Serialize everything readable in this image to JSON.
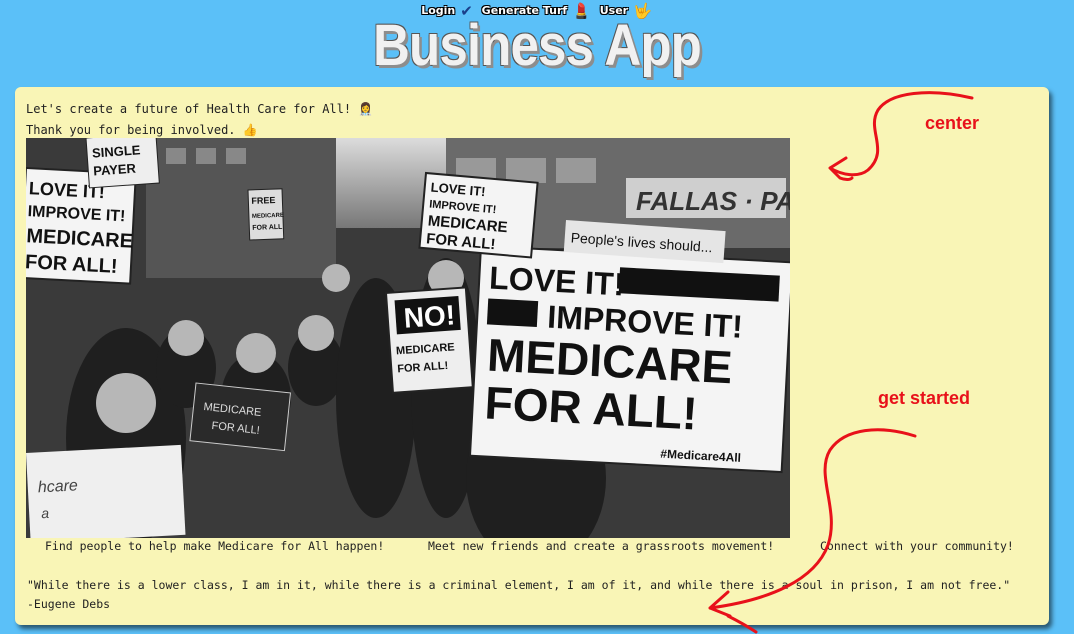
{
  "nav": {
    "items": [
      {
        "label": "Login",
        "icon": "✔"
      },
      {
        "label": "Generate Turf",
        "icon": "💄"
      },
      {
        "label": "User",
        "icon": "🤟"
      }
    ]
  },
  "app_title": "Business App",
  "intro": {
    "line1": "Let's create a future of Health Care for All!",
    "line1_icon": "👩‍⚕️",
    "line2": "Thank you for being involved.",
    "line2_icon": "👍"
  },
  "photo": {
    "signs": [
      {
        "lines": [
          "LOVE IT!",
          "IMPROVE IT!",
          "MEDICARE",
          "FOR ALL!",
          "#Medicare4All"
        ]
      },
      {
        "lines": [
          "LOVE IT!",
          "IMPROVE IT!",
          "MEDICARE",
          "FOR ALL!"
        ]
      },
      {
        "lines": [
          "SINGLE",
          "PAYER"
        ]
      },
      {
        "lines": [
          "NO!"
        ]
      },
      {
        "lines": [
          "FREE",
          "MEDICARE",
          "FOR ALL"
        ]
      },
      {
        "lines": [
          "People's lives should..."
        ]
      },
      {
        "lines": [
          "FALLAS · PAREDES"
        ]
      }
    ]
  },
  "features": [
    "Find people to help make Medicare for All happen!",
    "Meet new friends and create a grassroots movement!",
    "Connect with your community!"
  ],
  "quote": {
    "text": "\"While there is a lower class, I am in it, while there is a criminal element, I am of it, and while there is a soul in prison, I am not free.\"",
    "author": "-Eugene Debs"
  },
  "annotations": {
    "center": "center",
    "get_started": "get started"
  },
  "colors": {
    "background": "#5bc0f8",
    "card": "#f9f5b6",
    "annotation": "#e8111a"
  }
}
